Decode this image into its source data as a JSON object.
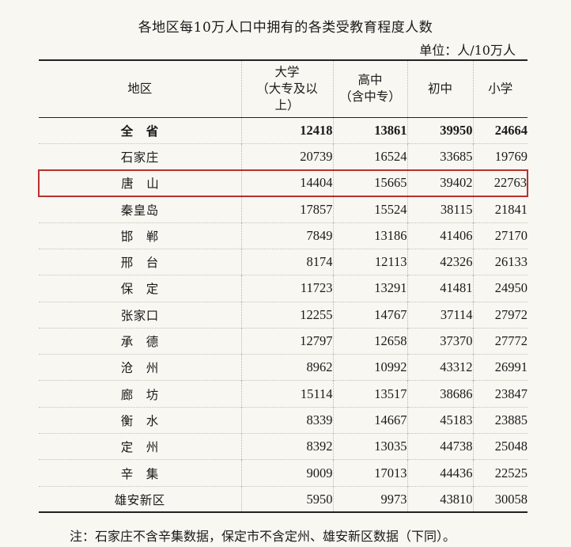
{
  "title": "各地区每10万人口中拥有的各类受教育程度人数",
  "unit": "单位：人/10万人",
  "headers": {
    "region": "地区",
    "college": "大学\n（大专及以上）",
    "high": "高中\n（含中专）",
    "junior": "初中",
    "primary": "小学"
  },
  "rows": [
    {
      "region": "全　省",
      "college": "12418",
      "high": "13861",
      "junior": "39950",
      "primary": "24664"
    },
    {
      "region": "石家庄",
      "college": "20739",
      "high": "16524",
      "junior": "33685",
      "primary": "19769"
    },
    {
      "region": "唐　山",
      "college": "14404",
      "high": "15665",
      "junior": "39402",
      "primary": "22763"
    },
    {
      "region": "秦皇岛",
      "college": "17857",
      "high": "15524",
      "junior": "38115",
      "primary": "21841"
    },
    {
      "region": "邯　郸",
      "college": "7849",
      "high": "13186",
      "junior": "41406",
      "primary": "27170"
    },
    {
      "region": "邢　台",
      "college": "8174",
      "high": "12113",
      "junior": "42326",
      "primary": "26133"
    },
    {
      "region": "保　定",
      "college": "11723",
      "high": "13291",
      "junior": "41481",
      "primary": "24950"
    },
    {
      "region": "张家口",
      "college": "12255",
      "high": "14767",
      "junior": "37114",
      "primary": "27972"
    },
    {
      "region": "承　德",
      "college": "12797",
      "high": "12658",
      "junior": "37370",
      "primary": "27772"
    },
    {
      "region": "沧　州",
      "college": "8962",
      "high": "10992",
      "junior": "43312",
      "primary": "26991"
    },
    {
      "region": "廊　坊",
      "college": "15114",
      "high": "13517",
      "junior": "38686",
      "primary": "23847"
    },
    {
      "region": "衡　水",
      "college": "8339",
      "high": "14667",
      "junior": "45183",
      "primary": "23885"
    },
    {
      "region": "定　州",
      "college": "8392",
      "high": "13035",
      "junior": "44738",
      "primary": "25048"
    },
    {
      "region": "辛　集",
      "college": "9009",
      "high": "17013",
      "junior": "44436",
      "primary": "22525"
    },
    {
      "region": "雄安新区",
      "college": "5950",
      "high": "9973",
      "junior": "43810",
      "primary": "30058"
    }
  ],
  "highlight_color": "#b8312f",
  "note": "注：石家庄不含辛集数据，保定市不含定州、雄安新区数据（下同）。"
}
